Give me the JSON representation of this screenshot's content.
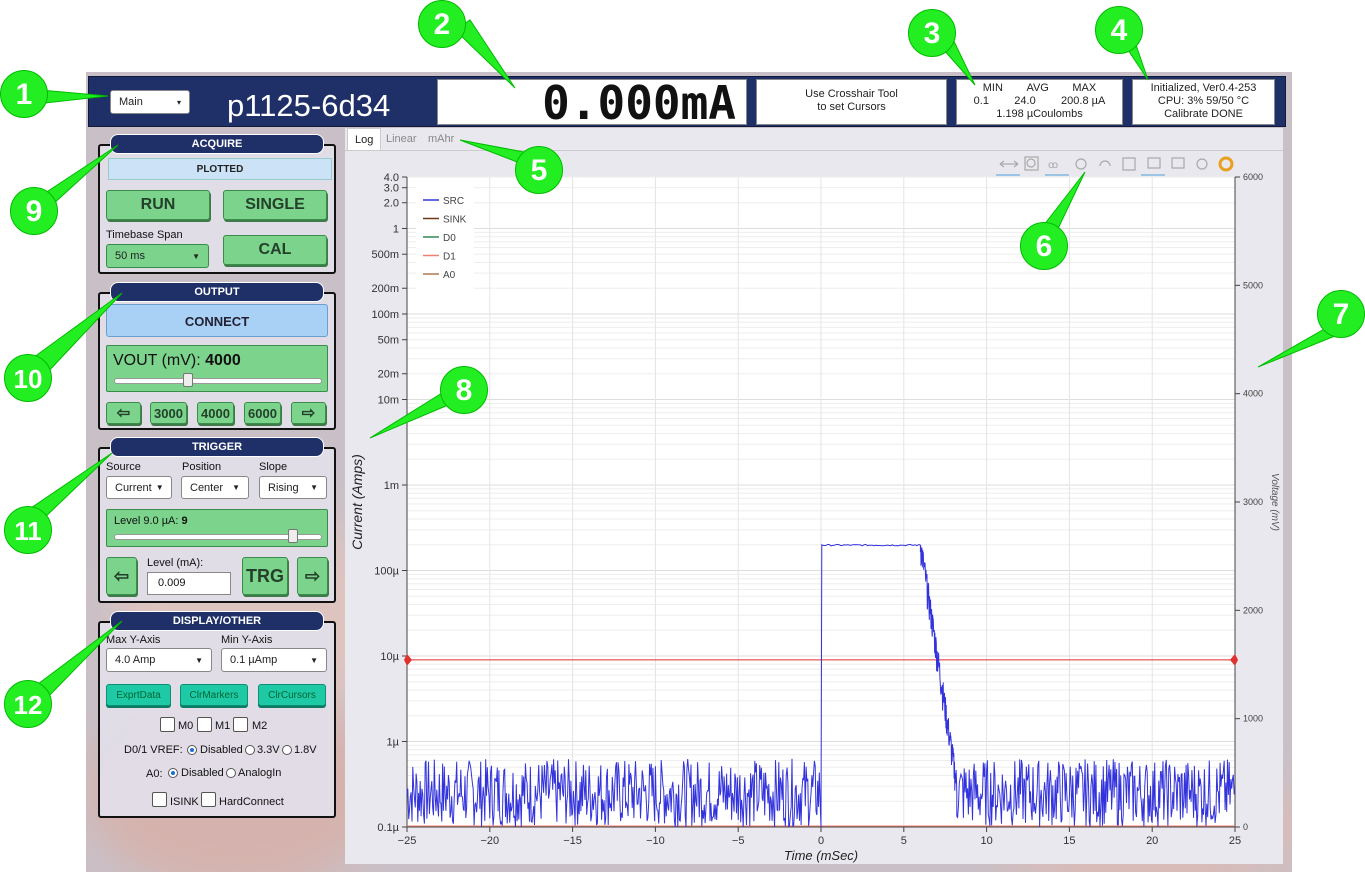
{
  "callouts": [
    "1",
    "2",
    "3",
    "4",
    "5",
    "6",
    "7",
    "8",
    "9",
    "10",
    "11",
    "12"
  ],
  "topbar": {
    "menu_label": "Main",
    "device_name": "p1125-6d34",
    "reading": "0.000mA",
    "cursor_hint": [
      "Use Crosshair Tool",
      "to set Cursors"
    ],
    "stats": {
      "headers": [
        "MIN",
        "AVG",
        "MAX"
      ],
      "values": [
        "0.1",
        "24.0",
        "200.8 µA"
      ],
      "charge": "1.198 µCoulombs"
    },
    "status": [
      "Initialized, Ver0.4-253",
      "CPU:  3% 59/50 °C",
      "Calibrate DONE"
    ]
  },
  "acquire": {
    "title": "ACQUIRE",
    "state": "PLOTTED",
    "run": "RUN",
    "single": "SINGLE",
    "timebase_label": "Timebase Span",
    "timebase_value": "50 ms",
    "cal": "CAL"
  },
  "output": {
    "title": "OUTPUT",
    "connect": "CONNECT",
    "vout_label": "VOUT (mV): ",
    "vout_value": "4000",
    "vout_slider_fraction": 0.35,
    "left_arrow": "⇦",
    "presets": [
      "3000",
      "4000",
      "6000"
    ],
    "right_arrow": "⇨"
  },
  "trigger": {
    "title": "TRIGGER",
    "source_label": "Source",
    "source_value": "Current",
    "position_label": "Position",
    "position_value": "Center",
    "slope_label": "Slope",
    "slope_value": "Rising",
    "level_label": "Level 9.0 µA: ",
    "level_value": "9",
    "level_slider_fraction": 0.88,
    "left_arrow": "⇦",
    "level_ma_label": "Level (mA):",
    "level_ma_value": "0.009",
    "trg": "TRG",
    "right_arrow": "⇨"
  },
  "display": {
    "title": "DISPLAY/OTHER",
    "max_y_label": "Max Y-Axis",
    "max_y_value": "4.0 Amp",
    "min_y_label": "Min Y-Axis",
    "min_y_value": "0.1 µAmp",
    "buttons": [
      "ExprtData",
      "ClrMarkers",
      "ClrCursors"
    ],
    "markers": [
      "M0",
      "M1",
      "M2"
    ],
    "vref_label": "D0/1 VREF:",
    "vref_options": [
      "Disabled",
      "3.3V",
      "1.8V"
    ],
    "a0_label": "A0:",
    "a0_options": [
      "Disabled",
      "AnalogIn"
    ],
    "isink": "ISINK",
    "hardconnect": "HardConnect"
  },
  "tabs": [
    "Log",
    "Linear",
    "mAhr"
  ],
  "colors": {
    "src": "#3333dd",
    "sink": "#6b3a1e",
    "d0": "#2e8b57",
    "d1": "#f08070",
    "a0": "#b07850",
    "trigger": "#e03030",
    "header": "#1f3068"
  },
  "chart_data": {
    "type": "line",
    "xlabel": "Time (mSec)",
    "ylabel": "Current (Amps)",
    "y2label": "Voltage (mV)",
    "xlim": [
      -25,
      25
    ],
    "ylim": [
      1e-07,
      4
    ],
    "y2lim": [
      0,
      6000
    ],
    "yscale": "log",
    "x_ticks": [
      "−25",
      "−20",
      "−15",
      "−10",
      "−5",
      "0",
      "5",
      "10",
      "15",
      "20",
      "25"
    ],
    "y_ticks": [
      {
        "v": 4,
        "t": "4.0"
      },
      {
        "v": 3,
        "t": "3.0"
      },
      {
        "v": 2,
        "t": "2.0"
      },
      {
        "v": 1,
        "t": "1"
      },
      {
        "v": 0.5,
        "t": "500m"
      },
      {
        "v": 0.2,
        "t": "200m"
      },
      {
        "v": 0.1,
        "t": "100m"
      },
      {
        "v": 0.05,
        "t": "50m"
      },
      {
        "v": 0.02,
        "t": "20m"
      },
      {
        "v": 0.01,
        "t": "10m"
      },
      {
        "v": 0.001,
        "t": "1m"
      },
      {
        "v": 0.0001,
        "t": "100µ"
      },
      {
        "v": 1e-05,
        "t": "10µ"
      },
      {
        "v": 1e-06,
        "t": "1µ"
      },
      {
        "v": 1e-07,
        "t": "0.1µ"
      }
    ],
    "y2_ticks": [
      "0",
      "1000",
      "2000",
      "3000",
      "4000",
      "5000",
      "6000"
    ],
    "legend": [
      "SRC",
      "SINK",
      "D0",
      "D1",
      "A0"
    ],
    "trigger_level": 9e-06,
    "series": [
      {
        "name": "SRC",
        "segments": [
          {
            "x": -25,
            "y": "noise"
          },
          {
            "x": 0,
            "y": 1e-07
          },
          {
            "x": 0.1,
            "y": 0.0002
          },
          {
            "x": 6,
            "y": 0.0002
          },
          {
            "x": 7,
            "y": 3e-06
          },
          {
            "x": 8,
            "y": 3e-07
          },
          {
            "x": 25,
            "y": "noise"
          }
        ]
      },
      {
        "name": "D1",
        "values": "flat 0"
      }
    ]
  }
}
